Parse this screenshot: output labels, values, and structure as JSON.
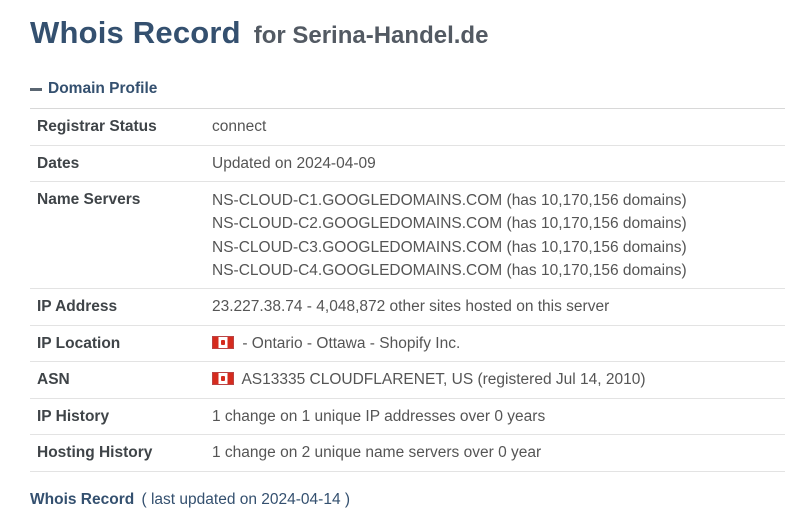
{
  "title": {
    "main": "Whois Record",
    "sub": "for Serina-Handel.de"
  },
  "section": {
    "label": "Domain Profile",
    "icon": "minus-icon"
  },
  "profile": {
    "registrar_status": {
      "label": "Registrar Status",
      "value": "connect"
    },
    "dates": {
      "label": "Dates",
      "value": "Updated on 2024-04-09"
    },
    "name_servers": {
      "label": "Name Servers",
      "values": [
        "NS-CLOUD-C1.GOOGLEDOMAINS.COM (has 10,170,156 domains)",
        "NS-CLOUD-C2.GOOGLEDOMAINS.COM (has 10,170,156 domains)",
        "NS-CLOUD-C3.GOOGLEDOMAINS.COM (has 10,170,156 domains)",
        "NS-CLOUD-C4.GOOGLEDOMAINS.COM (has 10,170,156 domains)"
      ]
    },
    "ip_address": {
      "label": "IP Address",
      "value": "23.227.38.74 - 4,048,872 other sites hosted on this server"
    },
    "ip_location": {
      "label": "IP Location",
      "value": "- Ontario - Ottawa - Shopify Inc.",
      "flag": "canada-flag-icon"
    },
    "asn": {
      "label": "ASN",
      "value": "AS13335 CLOUDFLARENET, US (registered Jul 14, 2010)",
      "flag": "canada-flag-icon"
    },
    "ip_history": {
      "label": "IP History",
      "value": "1 change on 1 unique IP addresses over 0 years"
    },
    "hosting_history": {
      "label": "Hosting History",
      "value": "1 change on 2 unique name servers over 0 year"
    }
  },
  "footer": {
    "link": "Whois Record",
    "updated": "( last updated on 2024-04-14 )"
  },
  "colors": {
    "heading": "#34506f",
    "label": "#3f4448",
    "text": "#555555",
    "divider": "#e3e3e3",
    "flag_red": "#d52b1e"
  }
}
